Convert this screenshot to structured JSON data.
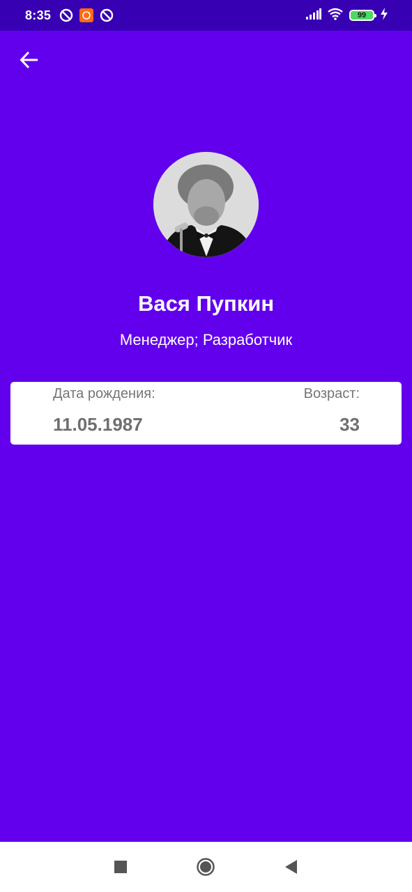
{
  "status_bar": {
    "time": "8:35",
    "battery_level": "99",
    "icons": [
      "no-disturb-icon",
      "app-notification-icon",
      "no-disturb-icon",
      "signal-icon",
      "wifi-icon",
      "battery-icon",
      "charging-icon"
    ]
  },
  "header": {
    "back_icon": "arrow-left-icon"
  },
  "profile": {
    "name": "Вася Пупкин",
    "role": "Менеджер; Разработчик"
  },
  "info_card": {
    "birth_date_label": "Дата рождения:",
    "birth_date_value": "11.05.1987",
    "age_label": "Возраст:",
    "age_value": "33"
  },
  "nav_bar": {
    "buttons": [
      "recents-icon",
      "home-icon",
      "back-triangle-icon"
    ]
  },
  "colors": {
    "background": "#6200EE",
    "status_bar": "#3700B3",
    "card": "#FFFFFF",
    "battery": "#4CD964"
  }
}
